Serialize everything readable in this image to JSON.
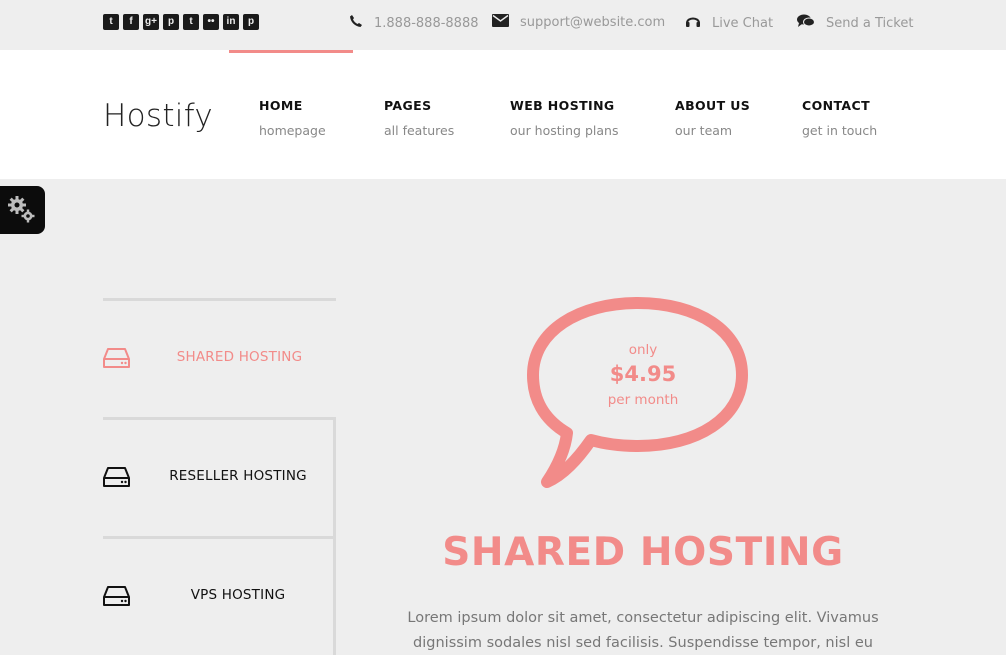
{
  "topbar": {
    "social_icons": [
      "twitter-icon",
      "facebook-icon",
      "google-plus-icon",
      "pinterest-icon",
      "tumblr-icon",
      "flickr-icon",
      "linkedin-icon",
      "pinterest-icon"
    ],
    "social_glyphs": [
      "t",
      "f",
      "g+",
      "p",
      "t",
      "••",
      "in",
      "p"
    ],
    "phone": "1.888-888-8888",
    "email": "support@website.com",
    "live_chat": "Live Chat",
    "ticket": "Send a Ticket"
  },
  "header": {
    "logo": "Hostify",
    "nav": [
      {
        "title": "HOME",
        "sub": "homepage"
      },
      {
        "title": "PAGES",
        "sub": "all features"
      },
      {
        "title": "WEB HOSTING",
        "sub": "our hosting plans"
      },
      {
        "title": "ABOUT US",
        "sub": "our team"
      },
      {
        "title": "CONTACT",
        "sub": "get in touch"
      }
    ]
  },
  "tabs": [
    {
      "label": "SHARED HOSTING",
      "active": true
    },
    {
      "label": "RESELLER HOSTING",
      "active": false
    },
    {
      "label": "VPS HOSTING",
      "active": false
    }
  ],
  "price": {
    "prefix": "only",
    "value": "$4.95",
    "period": "per month"
  },
  "main": {
    "title": "SHARED HOSTING",
    "description": "Lorem ipsum dolor sit amet, consectetur adipiscing elit. Vivamus dignissim sodales nisl sed facilisis. Suspendisse tempor, nisl eu sollicitudin feugiat,"
  },
  "colors": {
    "accent": "#f28b89",
    "topbar_bg": "#eeeeee",
    "header_bg": "#ffffff",
    "text_dark": "#111111"
  }
}
